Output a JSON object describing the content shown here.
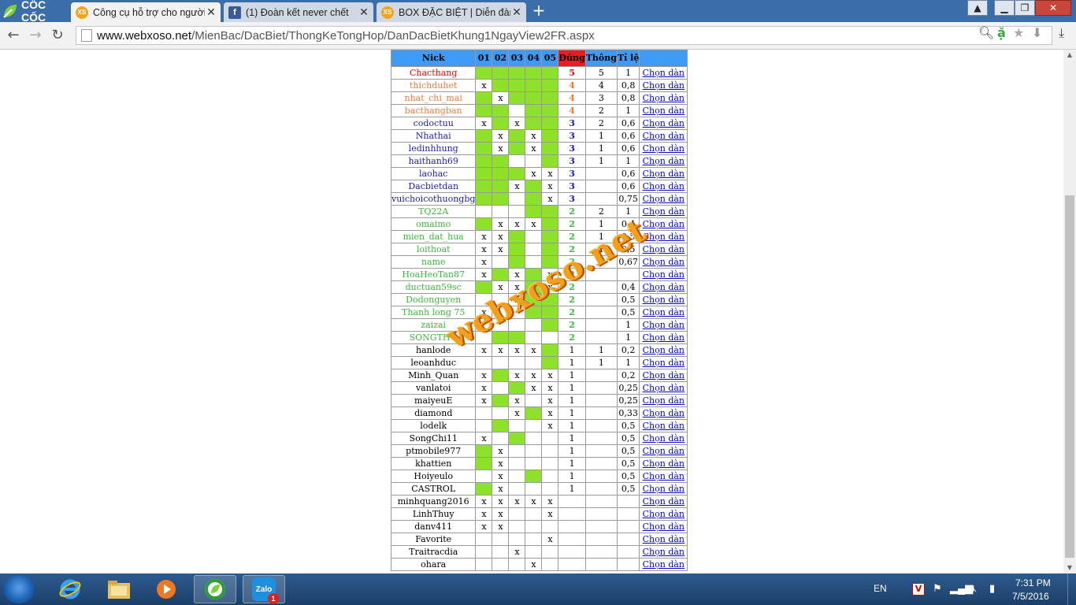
{
  "browser": {
    "brand": "CỐC CỐC",
    "tabs": [
      {
        "title": "Công cụ hỗ trợ cho người",
        "favicon": "XS",
        "active": true
      },
      {
        "title": "(1) Đoàn kết never chết",
        "favicon": "f",
        "active": false
      },
      {
        "title": "BOX ĐẶC BIỆT | Diễn đàn",
        "favicon": "XS",
        "active": false
      }
    ],
    "url_host": "www.webxoso.net",
    "url_path": "/MienBac/DacBiet/ThongKeTongHop/DanDacBietKhung1NgayView2FR.aspx"
  },
  "table": {
    "headers": [
      "Nick",
      "01",
      "02",
      "03",
      "04",
      "05",
      "Đúng",
      "Thông",
      "Tỉ lệ",
      ""
    ],
    "link_label": "Chọn dàn",
    "rows": [
      {
        "nick": "Chacthang",
        "color": "red",
        "cells": [
          "g",
          "g",
          "g",
          "g",
          "g"
        ],
        "dung": "5",
        "thong": "5",
        "tile": "1"
      },
      {
        "nick": "thichduhet",
        "color": "org",
        "cells": [
          "x",
          "g",
          "g",
          "g",
          "g"
        ],
        "dung": "4",
        "thong": "4",
        "tile": "0,8"
      },
      {
        "nick": "nhat_chi_mai",
        "color": "org",
        "cells": [
          "g",
          "x",
          "g",
          "g",
          "g"
        ],
        "dung": "4",
        "thong": "3",
        "tile": "0,8"
      },
      {
        "nick": "bacthangban",
        "color": "org",
        "cells": [
          "g",
          "g",
          "",
          "g",
          "g"
        ],
        "dung": "4",
        "thong": "2",
        "tile": "1"
      },
      {
        "nick": "codoctuu",
        "color": "blu",
        "cells": [
          "x",
          "g",
          "x",
          "g",
          "g"
        ],
        "dung": "3",
        "thong": "2",
        "tile": "0,6"
      },
      {
        "nick": "Nhathai",
        "color": "blu",
        "cells": [
          "g",
          "x",
          "g",
          "x",
          "g"
        ],
        "dung": "3",
        "thong": "1",
        "tile": "0,6"
      },
      {
        "nick": "ledinhhung",
        "color": "blu",
        "cells": [
          "g",
          "x",
          "g",
          "x",
          "g"
        ],
        "dung": "3",
        "thong": "1",
        "tile": "0,6"
      },
      {
        "nick": "haithanh69",
        "color": "blu",
        "cells": [
          "g",
          "g",
          "",
          "",
          "g"
        ],
        "dung": "3",
        "thong": "1",
        "tile": "1"
      },
      {
        "nick": "laohac",
        "color": "blu",
        "cells": [
          "g",
          "g",
          "g",
          "x",
          "x"
        ],
        "dung": "3",
        "thong": "",
        "tile": "0,6"
      },
      {
        "nick": "Dacbietdan",
        "color": "blu",
        "cells": [
          "g",
          "g",
          "x",
          "g",
          "x"
        ],
        "dung": "3",
        "thong": "",
        "tile": "0,6"
      },
      {
        "nick": "vuichoicothuongbg",
        "color": "blu",
        "cells": [
          "g",
          "g",
          "",
          "g",
          "x"
        ],
        "dung": "3",
        "thong": "",
        "tile": "0,75"
      },
      {
        "nick": "TQ22A",
        "color": "grn",
        "cells": [
          "",
          "",
          "",
          "g",
          "g"
        ],
        "dung": "2",
        "thong": "2",
        "tile": "1"
      },
      {
        "nick": "omaimo",
        "color": "grn",
        "cells": [
          "g",
          "x",
          "x",
          "x",
          "g"
        ],
        "dung": "2",
        "thong": "1",
        "tile": "0,4"
      },
      {
        "nick": "mien_dat_hua",
        "color": "grn",
        "cells": [
          "x",
          "x",
          "g",
          "",
          "g"
        ],
        "dung": "2",
        "thong": "1",
        "tile": "0,5"
      },
      {
        "nick": "loithoat",
        "color": "grn",
        "cells": [
          "x",
          "x",
          "g",
          "",
          "g"
        ],
        "dung": "2",
        "thong": "1",
        "tile": "0,5"
      },
      {
        "nick": "name",
        "color": "grn",
        "cells": [
          "x",
          "",
          "g",
          "",
          "g"
        ],
        "dung": "2",
        "thong": "1",
        "tile": "0,67"
      },
      {
        "nick": "HoaHeoTan87",
        "color": "grn",
        "cells": [
          "x",
          "g",
          "x",
          "g",
          "x"
        ],
        "dung": "2",
        "thong": "",
        "tile": ""
      },
      {
        "nick": "ductuan59sc",
        "color": "grn",
        "cells": [
          "g",
          "x",
          "x",
          "g",
          "x"
        ],
        "dung": "2",
        "thong": "",
        "tile": "0,4"
      },
      {
        "nick": "Dodonguyen",
        "color": "grn",
        "cells": [
          "",
          "",
          "x",
          "g",
          "g"
        ],
        "dung": "2",
        "thong": "",
        "tile": "0,5"
      },
      {
        "nick": "Thanh long 75",
        "color": "grn",
        "cells": [
          "x",
          "",
          "",
          "g",
          "g"
        ],
        "dung": "2",
        "thong": "",
        "tile": "0,5"
      },
      {
        "nick": "zaizai",
        "color": "grn",
        "cells": [
          "",
          "",
          "",
          "",
          "g"
        ],
        "dung": "2",
        "thong": "",
        "tile": "1"
      },
      {
        "nick": "SONGTHU",
        "color": "grn",
        "cells": [
          "",
          "g",
          "g",
          "",
          ""
        ],
        "dung": "2",
        "thong": "",
        "tile": "1"
      },
      {
        "nick": "hanlode",
        "color": "blk",
        "cells": [
          "x",
          "x",
          "x",
          "x",
          "g"
        ],
        "dung": "1",
        "thong": "1",
        "tile": "0,2"
      },
      {
        "nick": "leoanhduc",
        "color": "blk",
        "cells": [
          "",
          "",
          "",
          "",
          "g"
        ],
        "dung": "1",
        "thong": "1",
        "tile": "1"
      },
      {
        "nick": "Minh_Quan",
        "color": "blk",
        "cells": [
          "x",
          "g",
          "x",
          "x",
          "x"
        ],
        "dung": "1",
        "thong": "",
        "tile": "0,2"
      },
      {
        "nick": "vanlatoi",
        "color": "blk",
        "cells": [
          "x",
          "",
          "g",
          "x",
          "x"
        ],
        "dung": "1",
        "thong": "",
        "tile": "0,25"
      },
      {
        "nick": "maiyeuE",
        "color": "blk",
        "cells": [
          "x",
          "g",
          "x",
          "",
          "x"
        ],
        "dung": "1",
        "thong": "",
        "tile": "0,25"
      },
      {
        "nick": "diamond",
        "color": "blk",
        "cells": [
          "",
          "",
          "x",
          "g",
          "x"
        ],
        "dung": "1",
        "thong": "",
        "tile": "0,33"
      },
      {
        "nick": "lodelk",
        "color": "blk",
        "cells": [
          "",
          "g",
          "",
          "",
          "x"
        ],
        "dung": "1",
        "thong": "",
        "tile": "0,5"
      },
      {
        "nick": "SongChi11",
        "color": "blk",
        "cells": [
          "x",
          "",
          "g",
          "",
          ""
        ],
        "dung": "1",
        "thong": "",
        "tile": "0,5"
      },
      {
        "nick": "ptmobile977",
        "color": "blk",
        "cells": [
          "g",
          "x",
          "",
          "",
          ""
        ],
        "dung": "1",
        "thong": "",
        "tile": "0,5"
      },
      {
        "nick": "khattien",
        "color": "blk",
        "cells": [
          "g",
          "x",
          "",
          "",
          ""
        ],
        "dung": "1",
        "thong": "",
        "tile": "0,5"
      },
      {
        "nick": "Hoiyeulo",
        "color": "blk",
        "cells": [
          "",
          "x",
          "",
          "g",
          ""
        ],
        "dung": "1",
        "thong": "",
        "tile": "0,5"
      },
      {
        "nick": "CASTROL",
        "color": "blk",
        "cells": [
          "g",
          "x",
          "",
          "",
          ""
        ],
        "dung": "1",
        "thong": "",
        "tile": "0,5"
      },
      {
        "nick": "minhquang2016",
        "color": "blk",
        "cells": [
          "x",
          "x",
          "x",
          "x",
          "x"
        ],
        "dung": "",
        "thong": "",
        "tile": ""
      },
      {
        "nick": "LinhThuy",
        "color": "blk",
        "cells": [
          "x",
          "x",
          "",
          "",
          "x"
        ],
        "dung": "",
        "thong": "",
        "tile": ""
      },
      {
        "nick": "danv411",
        "color": "blk",
        "cells": [
          "x",
          "x",
          "",
          "",
          ""
        ],
        "dung": "",
        "thong": "",
        "tile": ""
      },
      {
        "nick": "Favorite",
        "color": "blk",
        "cells": [
          "",
          "",
          "",
          "",
          "x"
        ],
        "dung": "",
        "thong": "",
        "tile": ""
      },
      {
        "nick": "Traitracdia",
        "color": "blk",
        "cells": [
          "",
          "",
          "x",
          "",
          ""
        ],
        "dung": "",
        "thong": "",
        "tile": ""
      },
      {
        "nick": "ohara",
        "color": "blk",
        "cells": [
          "",
          "",
          "",
          "x",
          ""
        ],
        "dung": "",
        "thong": "",
        "tile": ""
      }
    ]
  },
  "watermark": "webxoso.net",
  "taskbar": {
    "lang": "EN",
    "time": "7:31 PM",
    "date": "7/5/2016",
    "zalo_badge": "1",
    "zalo_label": "Zalo"
  }
}
